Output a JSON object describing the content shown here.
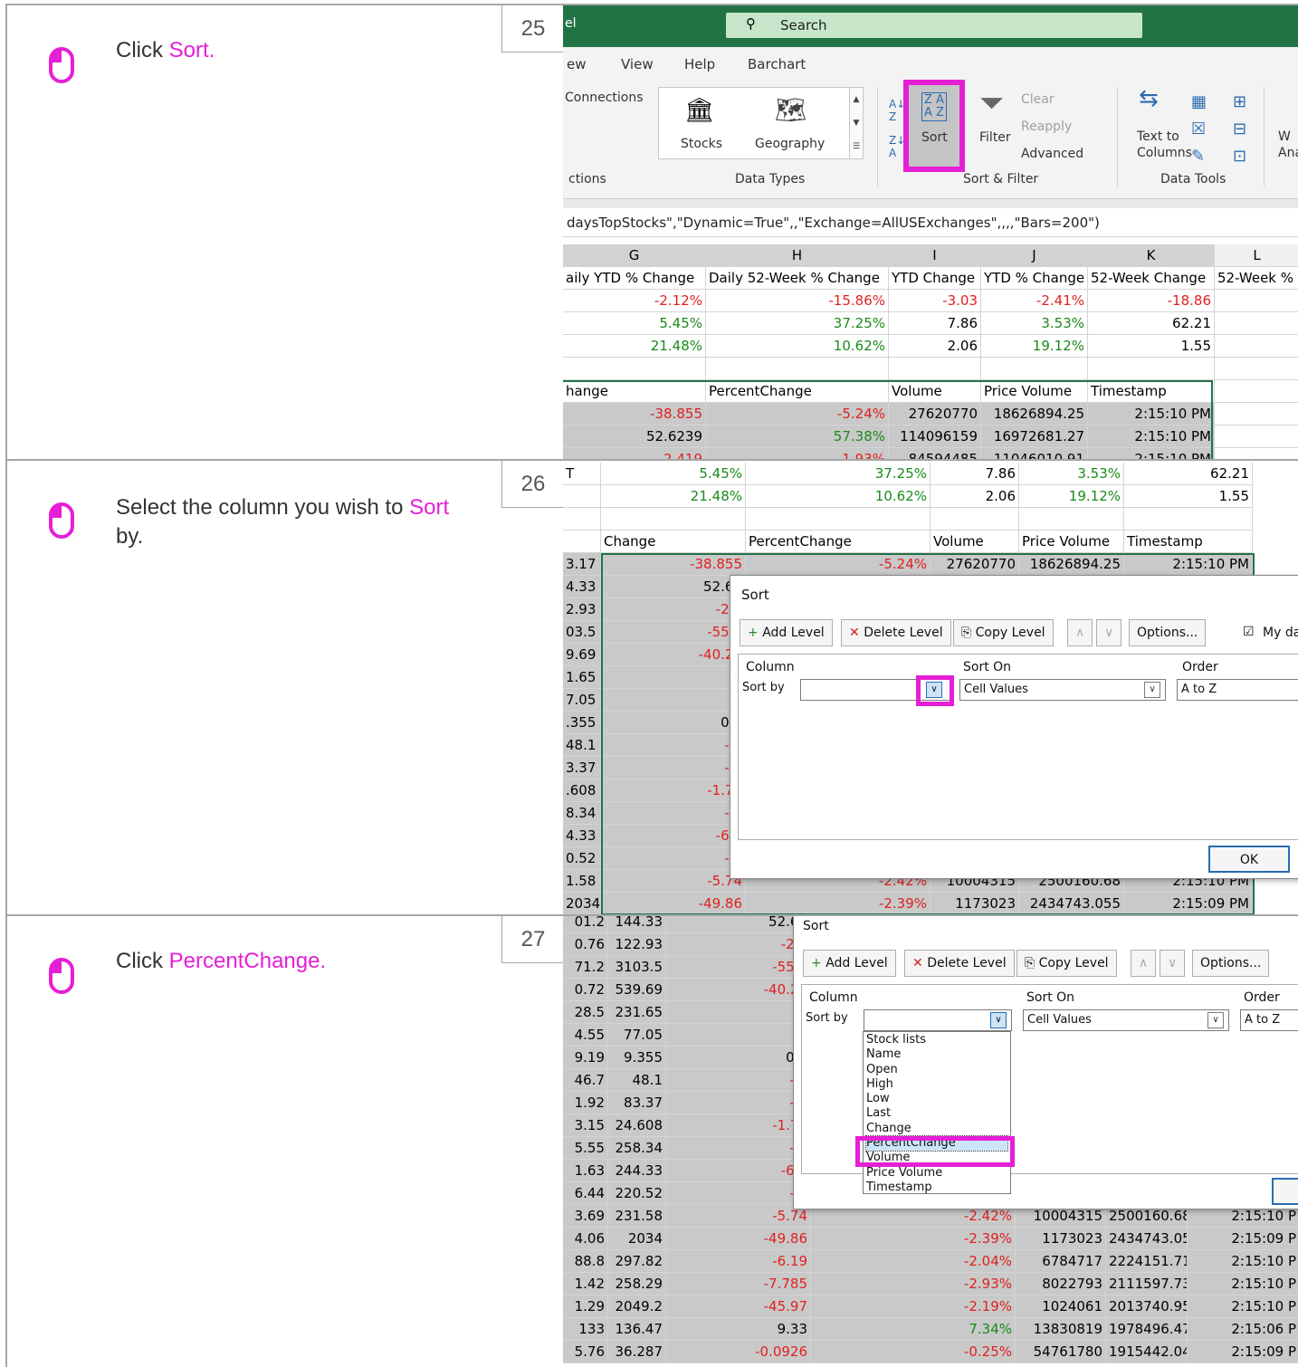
{
  "steps": [
    {
      "number": "25",
      "prefix": "Click ",
      "highlight": "Sort.",
      "suffix": ""
    },
    {
      "number": "26",
      "prefix": "Select the column you wish to ",
      "highlight": "Sort",
      "suffix": " by."
    },
    {
      "number": "27",
      "prefix": "Click ",
      "highlight": "PercentChange.",
      "suffix": ""
    }
  ],
  "s25": {
    "title_fragment": "el",
    "search_label": "Search",
    "tabs": [
      "ew",
      "View",
      "Help",
      "Barchart"
    ],
    "connections": "Connections",
    "group_connections": "ctions",
    "stocks": "Stocks",
    "geography": "Geography",
    "group_data_types": "Data Types",
    "sort": "Sort",
    "filter": "Filter",
    "clear": "Clear",
    "reapply": "Reapply",
    "advanced": "Advanced",
    "group_sort_filter": "Sort & Filter",
    "text_to": "Text to",
    "columns": "Columns",
    "group_data_tools": "Data Tools",
    "whatif_1": "W",
    "whatif_2": "Ana",
    "formula": "daysTopStocks\",\"Dynamic=True\",,\"Exchange=AllUSExchanges\",,,,\"Bars=200\")",
    "col_letters": [
      "G",
      "H",
      "I",
      "J",
      "K",
      "L"
    ],
    "header_row": [
      "aily YTD % Change",
      "Daily 52-Week % Change",
      "YTD Change",
      "YTD % Change",
      "52-Week Change",
      "52-Week %"
    ],
    "rows": [
      [
        "-2.12%",
        "-15.86%",
        "-3.03",
        "-2.41%",
        "-18.86",
        ""
      ],
      [
        "5.45%",
        "37.25%",
        "7.86",
        "3.53%",
        "62.21",
        ""
      ],
      [
        "21.48%",
        "10.62%",
        "2.06",
        "19.12%",
        "1.55",
        ""
      ],
      [
        "",
        "",
        "",
        "",
        "",
        ""
      ],
      [
        "hange",
        "PercentChange",
        "Volume",
        "Price Volume",
        "Timestamp",
        ""
      ],
      [
        "-38.855",
        "-5.24%",
        "27620770",
        "18626894.25",
        "2:15:10 PM",
        ""
      ],
      [
        "52.6239",
        "57.38%",
        "114096159",
        "16972681.27",
        "2:15:10 PM",
        ""
      ],
      [
        "-2.419",
        "-1.93%",
        "84594485",
        "11046010.91",
        "2:15:10 PM",
        ""
      ]
    ]
  },
  "s26": {
    "top_rows": [
      [
        "T",
        "5.45%",
        "37.25%",
        "7.86",
        "3.53%",
        "62.21"
      ],
      [
        "",
        "21.48%",
        "10.62%",
        "2.06",
        "19.12%",
        "1.55"
      ],
      [
        "",
        "",
        "",
        "",
        "",
        ""
      ],
      [
        "",
        "Change",
        "PercentChange",
        "Volume",
        "Price Volume",
        "Timestamp"
      ],
      [
        "3.17",
        "-38.855",
        "-5.24%",
        "27620770",
        "18626894.25",
        "2:15:10 PM"
      ]
    ],
    "left_col": [
      "4.33",
      "2.93",
      "03.5",
      "9.69",
      "1.65",
      "7.05",
      ".355",
      "48.1",
      "3.37",
      ".608",
      "8.34",
      "4.33",
      "0.52"
    ],
    "change_col": [
      "52.62",
      "-2.4",
      "-55.9",
      "-40.26",
      "-2",
      "5.",
      "0.2",
      "-3.",
      "-3.",
      "-1.78",
      "-5.",
      "-6.0",
      "-8."
    ],
    "bottom_rows": [
      [
        "1.58",
        "-5.74",
        "-2.42%",
        "10004315",
        "2500160.68",
        "2:15:10 PM"
      ],
      [
        "2034",
        "-49.86",
        "-2.39%",
        "1173023",
        "2434743.055",
        "2:15:09 PM"
      ]
    ]
  },
  "s27": {
    "rows_top": [
      [
        "01.2",
        "144.33",
        "52.62"
      ],
      [
        "0.76",
        "122.93",
        "-2.4"
      ],
      [
        "71.2",
        "3103.5",
        "-55.9"
      ],
      [
        "0.72",
        "539.69",
        "-40.26"
      ],
      [
        "28.5",
        "231.65",
        "-2"
      ],
      [
        "4.55",
        "77.05",
        "5."
      ],
      [
        "9.19",
        "9.355",
        "0.2"
      ],
      [
        "46.7",
        "48.1",
        "-3."
      ],
      [
        "1.92",
        "83.37",
        "-3."
      ],
      [
        "3.15",
        "24.608",
        "-1.78"
      ],
      [
        "5.55",
        "258.34",
        "-5."
      ],
      [
        "1.63",
        "244.33",
        "-6.0"
      ],
      [
        "6.44",
        "220.52",
        "-8."
      ]
    ],
    "rows_bottom": [
      [
        "3.69",
        "231.58",
        "-5.74",
        "-2.42%",
        "10004315",
        "2500160.68",
        "2:15:10 P"
      ],
      [
        "4.06",
        "2034",
        "-49.86",
        "-2.39%",
        "1173023",
        "2434743.055",
        "2:15:09 P"
      ],
      [
        "88.8",
        "297.82",
        "-6.19",
        "-2.04%",
        "6784717",
        "2224151.717",
        "2:15:10 P"
      ],
      [
        "1.42",
        "258.29",
        "-7.785",
        "-2.93%",
        "8022793",
        "2111597.738",
        "2:15:10 P"
      ],
      [
        "1.29",
        "2049.2",
        "-45.97",
        "-2.19%",
        "1024061",
        "2013740.958",
        "2:15:10 P"
      ],
      [
        "133",
        "136.47",
        "9.33",
        "7.34%",
        "13830819",
        "1978496.475",
        "2:15:06 P"
      ],
      [
        "5.76",
        "36.287",
        "-0.0926",
        "-0.25%",
        "54761780",
        "1915442.047",
        "2:15:09 P"
      ]
    ]
  },
  "dialog": {
    "title": "Sort",
    "add_level": "Add Level",
    "delete_level": "Delete Level",
    "copy_level": "Copy Level",
    "options": "Options...",
    "my_data": "My da",
    "col_column": "Column",
    "col_sort_on": "Sort On",
    "col_order": "Order",
    "sort_by": "Sort by",
    "cell_values": "Cell Values",
    "a_to_z": "A to Z",
    "ok": "OK",
    "dropdown_options": [
      "Stock lists",
      "Name",
      "Open",
      "High",
      "Low",
      "Last",
      "Change",
      "PercentChange",
      "Volume",
      "Price Volume",
      "Timestamp"
    ],
    "dropdown_selected": "PercentChange"
  },
  "colors": {
    "accent": "#e51fd6",
    "excel_green": "#217346",
    "negative": "#e02020",
    "positive": "#1a8a1a",
    "selected_gray": "#c9c9c9"
  }
}
